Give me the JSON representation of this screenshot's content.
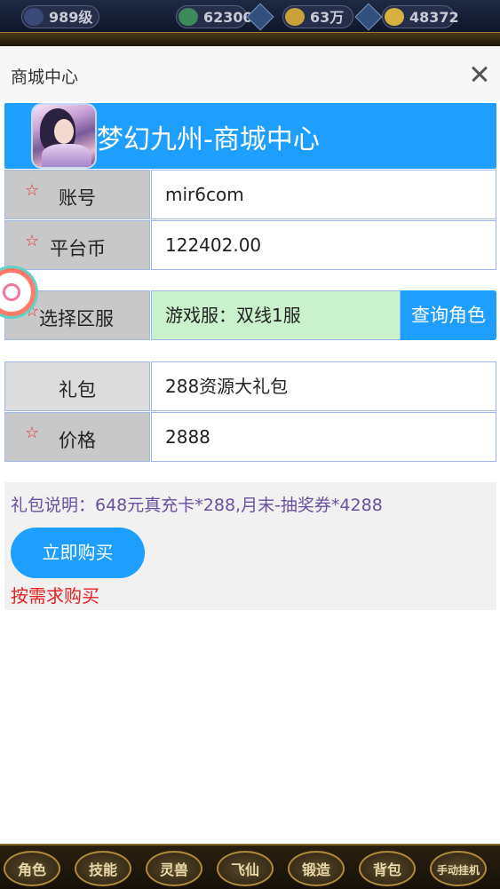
{
  "hud": {
    "level": "989级",
    "jade": "62300",
    "gold": "63万",
    "coins": "48372",
    "bottom_tabs": [
      "角色",
      "技能",
      "灵兽",
      "飞仙",
      "锻造",
      "背包",
      "手动挂机"
    ]
  },
  "modal": {
    "title": "商城中心"
  },
  "banner": {
    "title": "梦幻九州-商城中心"
  },
  "form": {
    "account_label": "账号",
    "account_value": "mir6com",
    "currency_label": "平台币",
    "currency_value": "122402.00",
    "server_label": "选择区服",
    "server_value": "游戏服：双线1服",
    "query_button": "查询角色",
    "package_label": "礼包",
    "package_value": "288资源大礼包",
    "price_label": "价格",
    "price_value": "2888"
  },
  "package_info": {
    "description": "礼包说明：648元真充卡*288,月末-抽奖券*4288",
    "buy_button": "立即购买",
    "note": "按需求购买"
  },
  "colors": {
    "accent": "#1e9eff",
    "required_star": "#e53030",
    "note": "#e81f1f",
    "description": "#6a4fa0"
  }
}
